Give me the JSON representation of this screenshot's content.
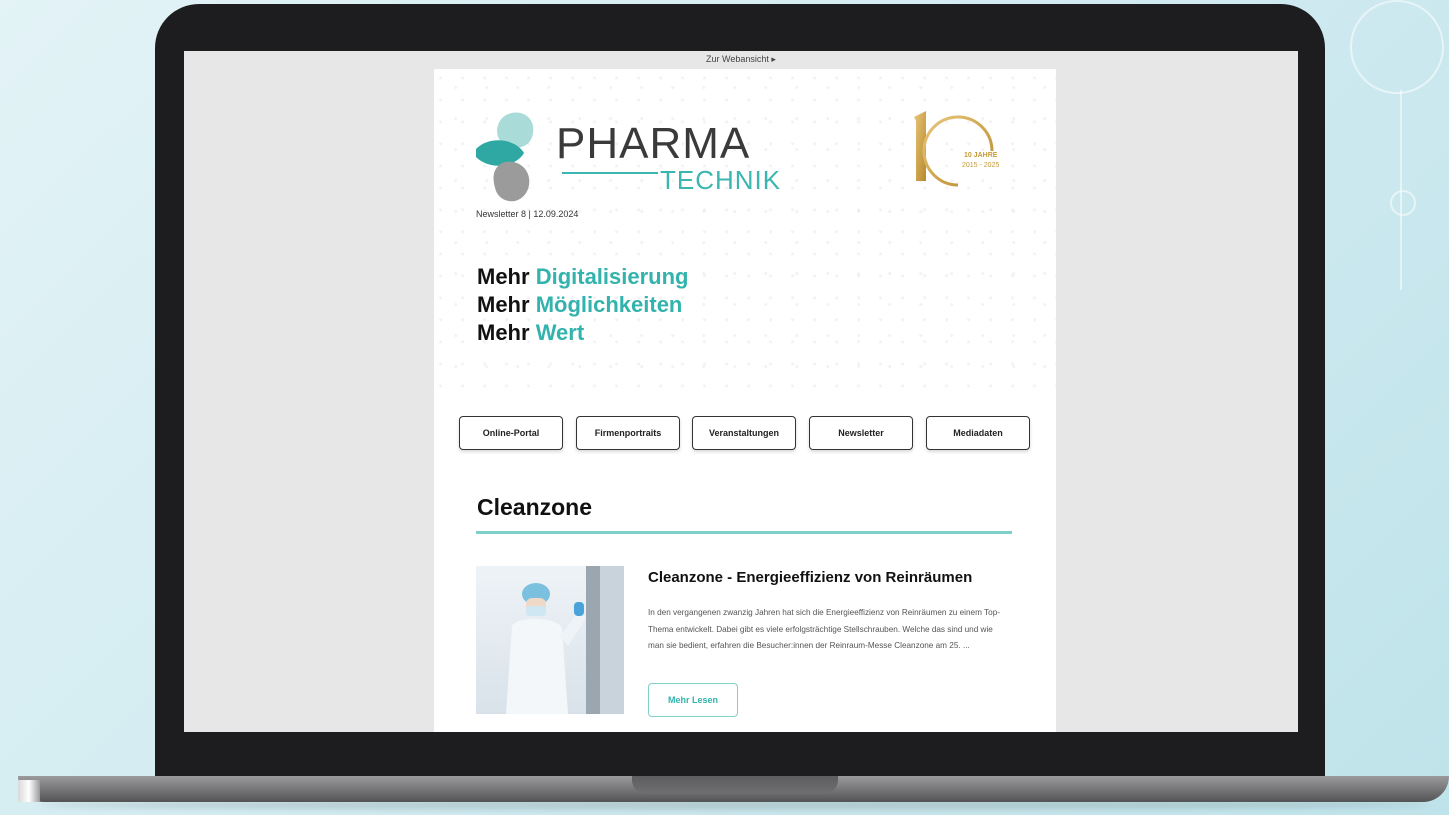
{
  "email": {
    "web_view_link": "Zur Webansicht ▸",
    "logo": {
      "word": "PHARMA",
      "sub": "TECHNIK"
    },
    "jubilee": {
      "line1": "10 JAHRE",
      "line2": "2015 - 2025"
    },
    "issue": "Newsletter 8 | 12.09.2024",
    "tagline": [
      {
        "lead": "Mehr",
        "accent": "Digitalisierung"
      },
      {
        "lead": "Mehr",
        "accent": "Möglichkeiten"
      },
      {
        "lead": "Mehr",
        "accent": "Wert"
      }
    ],
    "nav": [
      "Online-Portal",
      "Firmenportraits",
      "Veranstaltungen",
      "Newsletter",
      "Mediadaten"
    ],
    "section_title": "Cleanzone",
    "article": {
      "title": "Cleanzone - Energieeffizienz von Reinräumen",
      "text": "In den vergangenen zwanzig Jahren hat sich die Energieeffizienz von Reinräumen zu einem Top-Thema entwickelt. Dabei gibt es viele erfolgsträchtige Stellschrauben. Welche das sind und wie man sie bedient, erfahren die Besucher:innen der Reinraum-Messe Cleanzone am 25. ...",
      "button": "Mehr Lesen"
    }
  },
  "colors": {
    "accent": "#33b3ad",
    "gold": "#c69b3a"
  }
}
